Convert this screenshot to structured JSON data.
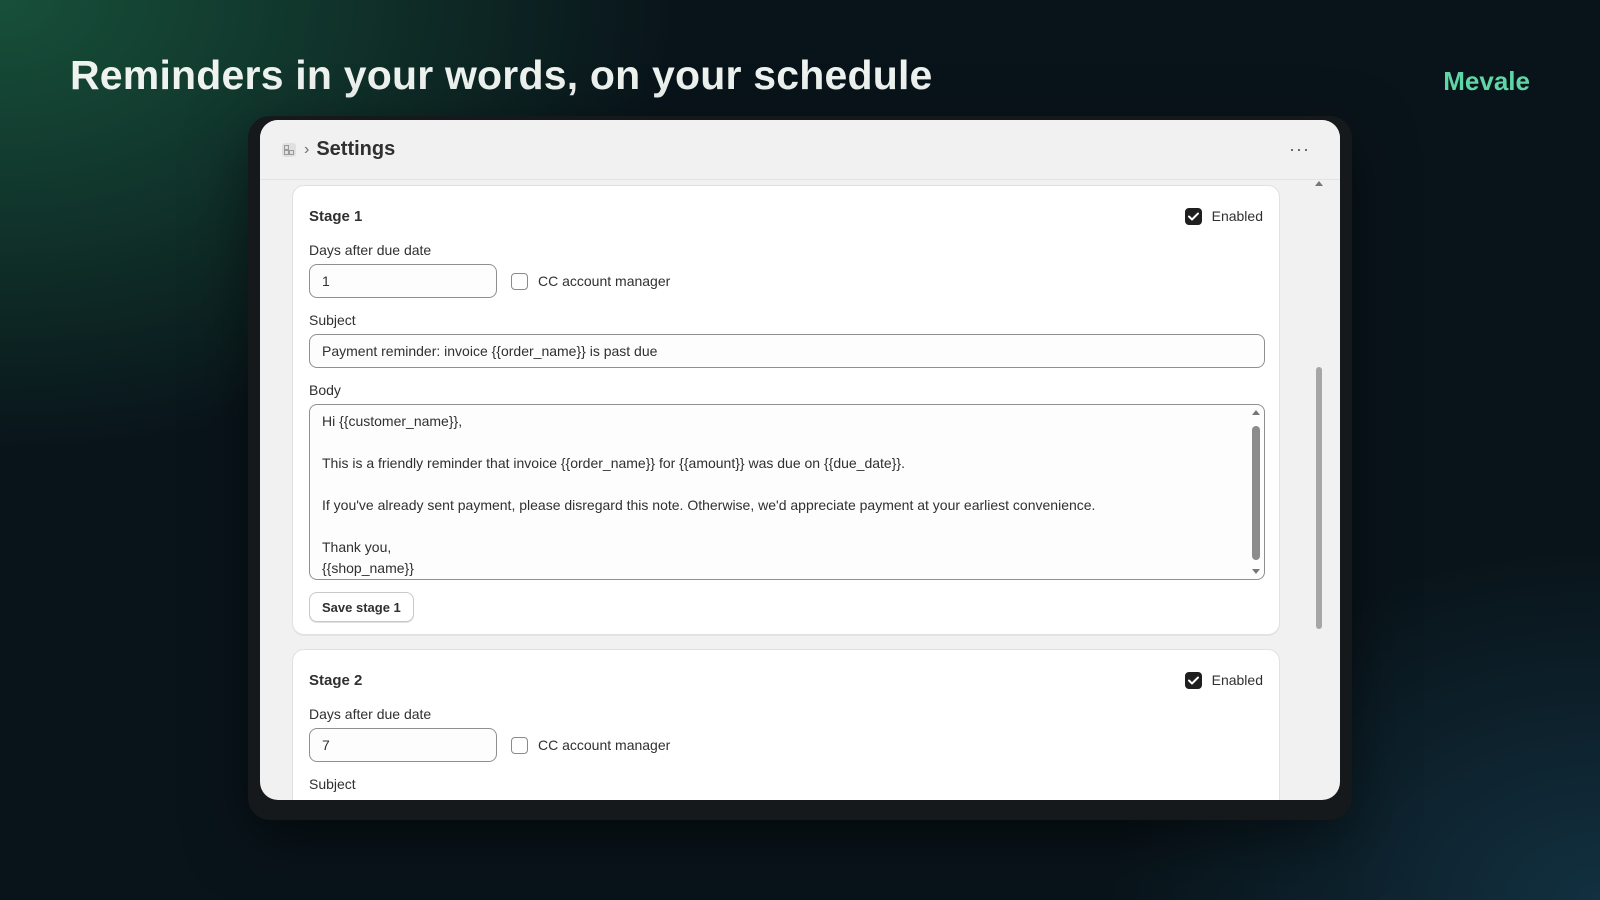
{
  "hero": {
    "headline": "Reminders in your words, on your schedule",
    "brand": "Mevale"
  },
  "window": {
    "title": "Settings",
    "more": "···"
  },
  "stages": [
    {
      "title": "Stage 1",
      "enabled_label": "Enabled",
      "enabled": true,
      "days_label": "Days after due date",
      "days_value": "1",
      "cc_label": "CC account manager",
      "cc_checked": false,
      "subject_label": "Subject",
      "subject_value": "Payment reminder: invoice {{order_name}} is past due",
      "body_label": "Body",
      "body_lines": [
        "Hi {{customer_name}},",
        "",
        "This is a friendly reminder that invoice {{order_name}} for {{amount}} was due on {{due_date}}.",
        "",
        "If you've already sent payment, please disregard this note. Otherwise, we'd appreciate payment at your earliest convenience.",
        "",
        "Thank you,",
        "{{shop_name}}"
      ],
      "save_label": "Save stage 1"
    },
    {
      "title": "Stage 2",
      "enabled_label": "Enabled",
      "enabled": true,
      "days_label": "Days after due date",
      "days_value": "7",
      "cc_label": "CC account manager",
      "cc_checked": false,
      "subject_label": "Subject"
    }
  ],
  "colors": {
    "brand": "#5fd6a6",
    "checkbox": "#1f1f1f"
  }
}
